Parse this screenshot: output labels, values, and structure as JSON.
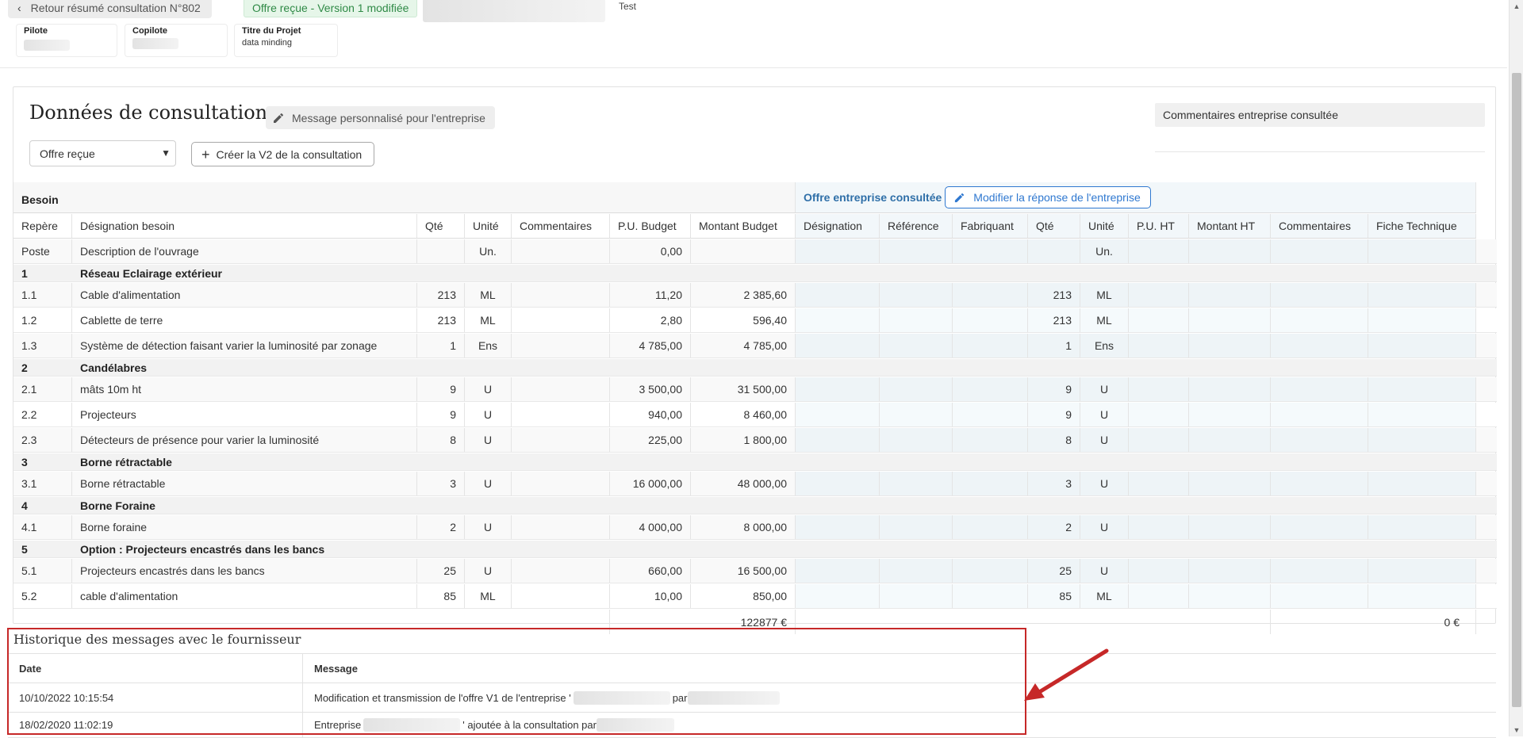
{
  "header": {
    "back_label": "Retour résumé consultation N°802",
    "status_badge": "Offre reçue - Version 1 modifiée",
    "test_label": "Test",
    "pilote_label": "Pilote",
    "copilote_label": "Copilote",
    "projet_label": "Titre du Projet",
    "projet_value": "data minding"
  },
  "panel": {
    "title": "Données de consultation",
    "message_button": "Message personnalisé pour l'entreprise",
    "comments_header": "Commentaires entreprise consultée",
    "offer_select_value": "Offre reçue",
    "create_button": "Créer la V2 de la consultation"
  },
  "table": {
    "section_besoin": "Besoin",
    "section_offre": "Offre entreprise consultée",
    "edit_offer_button": "Modifier la réponse de l'entreprise",
    "columns_besoin": [
      "Repère",
      "Désignation besoin",
      "Qté",
      "Unité",
      "Commentaires",
      "P.U. Budget",
      "Montant Budget"
    ],
    "columns_offre": [
      "Désignation",
      "Référence",
      "Fabriquant",
      "Qté",
      "Unité",
      "P.U. HT",
      "Montant HT",
      "Commentaires",
      "Fiche Technique"
    ],
    "rows": [
      {
        "type": "item",
        "ref": "Poste",
        "designation": "Description de l'ouvrage",
        "qte": "",
        "unite": "Un.",
        "pu": "0,00",
        "montant": "",
        "o_qte": "",
        "o_unite": "Un."
      },
      {
        "type": "section",
        "ref": "1",
        "designation": "Réseau Eclairage extérieur"
      },
      {
        "type": "item",
        "ref": "1.1",
        "designation": "Cable d'alimentation",
        "qte": "213",
        "unite": "ML",
        "pu": "11,20",
        "montant": "2 385,60",
        "o_qte": "213",
        "o_unite": "ML"
      },
      {
        "type": "item",
        "ref": "1.2",
        "designation": "Cablette de terre",
        "qte": "213",
        "unite": "ML",
        "pu": "2,80",
        "montant": "596,40",
        "o_qte": "213",
        "o_unite": "ML"
      },
      {
        "type": "item",
        "ref": "1.3",
        "designation": "Système de détection faisant varier la luminosité par zonage",
        "qte": "1",
        "unite": "Ens",
        "pu": "4 785,00",
        "montant": "4 785,00",
        "o_qte": "1",
        "o_unite": "Ens"
      },
      {
        "type": "section",
        "ref": "2",
        "designation": "Candélabres"
      },
      {
        "type": "item",
        "ref": "2.1",
        "designation": "mâts 10m ht",
        "qte": "9",
        "unite": "U",
        "pu": "3 500,00",
        "montant": "31 500,00",
        "o_qte": "9",
        "o_unite": "U"
      },
      {
        "type": "item",
        "ref": "2.2",
        "designation": "Projecteurs",
        "qte": "9",
        "unite": "U",
        "pu": "940,00",
        "montant": "8 460,00",
        "o_qte": "9",
        "o_unite": "U"
      },
      {
        "type": "item",
        "ref": "2.3",
        "designation": "Détecteurs de présence pour varier la luminosité",
        "qte": "8",
        "unite": "U",
        "pu": "225,00",
        "montant": "1 800,00",
        "o_qte": "8",
        "o_unite": "U"
      },
      {
        "type": "section",
        "ref": "3",
        "designation": "Borne rétractable"
      },
      {
        "type": "item",
        "ref": "3.1",
        "designation": "Borne rétractable",
        "qte": "3",
        "unite": "U",
        "pu": "16 000,00",
        "montant": "48 000,00",
        "o_qte": "3",
        "o_unite": "U"
      },
      {
        "type": "section",
        "ref": "4",
        "designation": "Borne Foraine"
      },
      {
        "type": "item",
        "ref": "4.1",
        "designation": "Borne foraine",
        "qte": "2",
        "unite": "U",
        "pu": "4 000,00",
        "montant": "8 000,00",
        "o_qte": "2",
        "o_unite": "U"
      },
      {
        "type": "section",
        "ref": "5",
        "designation": "Option : Projecteurs encastrés dans les bancs"
      },
      {
        "type": "item",
        "ref": "5.1",
        "designation": "Projecteurs encastrés dans les bancs",
        "qte": "25",
        "unite": "U",
        "pu": "660,00",
        "montant": "16 500,00",
        "o_qte": "25",
        "o_unite": "U"
      },
      {
        "type": "item",
        "ref": "5.2",
        "designation": "cable d'alimentation",
        "qte": "85",
        "unite": "ML",
        "pu": "10,00",
        "montant": "850,00",
        "o_qte": "85",
        "o_unite": "ML"
      }
    ],
    "total_budget": "122877 €",
    "total_offre": "0 €"
  },
  "history": {
    "title": "Historique des messages avec le fournisseur",
    "col_date": "Date",
    "col_message": "Message",
    "rows": [
      {
        "date": "10/10/2022 10:15:54",
        "msg_a": "Modification et transmission de l'offre V1 de l'entreprise '",
        "msg_b": "par"
      },
      {
        "date": "18/02/2020 11:02:19",
        "msg_a": "Entreprise",
        "msg_b": "' ajoutée à la consultation par"
      }
    ]
  },
  "colors": {
    "accent_blue": "#2f78d0",
    "status_green": "#2f8a46",
    "highlight_red": "#c62828"
  }
}
